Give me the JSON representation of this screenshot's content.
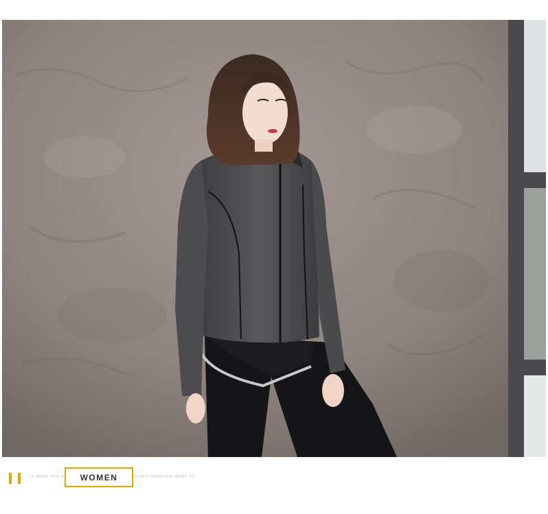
{
  "banner": {
    "photo_alt": "Woman in grey zip-up hooded sports jacket and black leggings posing against a textured concrete wall",
    "background_color": "#8d837e",
    "accent_color": "#e2a800"
  },
  "caption": {
    "tagline": "IS WHAT YOU WANT TO YOU   AT YOU WANT TO VELVET FABRICSIS WHAT YO",
    "section_title": "WOMEN"
  }
}
